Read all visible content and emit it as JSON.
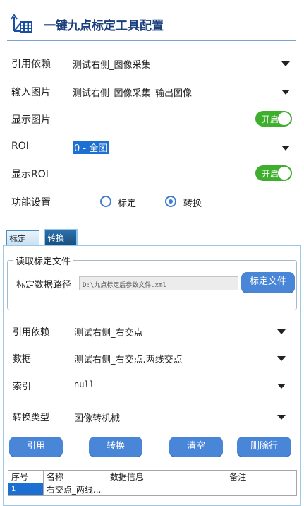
{
  "header": {
    "title": "一键九点标定工具配置",
    "icon": "grid-transform-icon",
    "accent_color": "#1a3d7c"
  },
  "form": {
    "ref_label": "引用依赖",
    "ref_value": "测试右侧_图像采集",
    "input_image_label": "输入图片",
    "input_image_value": "测试右侧_图像采集_输出图像",
    "show_image_label": "显示图片",
    "show_image_toggle": "开启",
    "roi_label": "ROI",
    "roi_value": "0 - 全图",
    "show_roi_label": "显示ROI",
    "show_roi_toggle": "开启",
    "function_label": "功能设置",
    "radio_calibrate": "标定",
    "radio_convert": "转换",
    "selected_mode": "转换"
  },
  "tabs": {
    "calibrate": "标定",
    "convert": "转换"
  },
  "calib_file": {
    "group_title": "读取标定文件",
    "path_label": "标定数据路径",
    "path_value": "D:\\九点标定后参数文件.xml",
    "button": "标定文件"
  },
  "convert": {
    "ref_label": "引用依赖",
    "ref_value": "测试右侧_右交点",
    "data_label": "数据",
    "data_value": "测试右侧_右交点.两线交点",
    "index_label": "索引",
    "index_value": "null",
    "type_label": "转换类型",
    "type_value": "图像转机械"
  },
  "buttons": {
    "reference": "引用",
    "convert": "转换",
    "clear": "清空",
    "delete_row": "删除行"
  },
  "table": {
    "headers": [
      "序号",
      "名称",
      "数据信息",
      "备注"
    ],
    "rows": [
      [
        "1",
        "右交点_两线...",
        "",
        ""
      ]
    ]
  },
  "colors": {
    "toggle_on": "#3daf2c",
    "button": "#4a86d8",
    "selected_cell": "#1d6fd1"
  }
}
